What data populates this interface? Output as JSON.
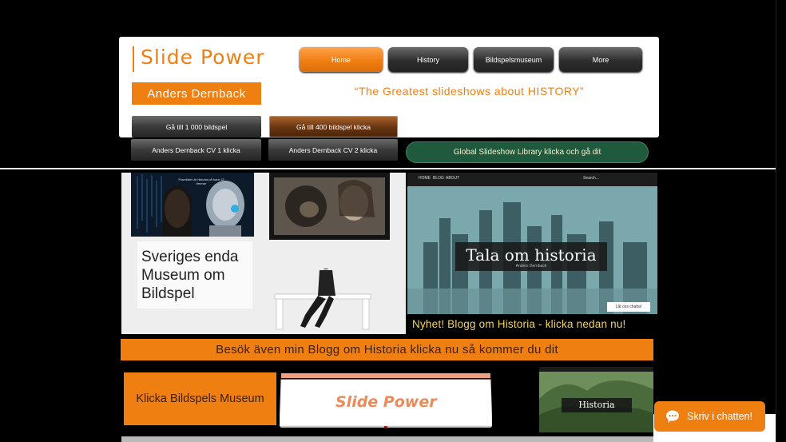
{
  "header": {
    "site_title": "Slide Power",
    "author": "Anders Dernback",
    "tagline": "“The Greatest slideshows about HISTORY”"
  },
  "nav": {
    "items": [
      {
        "label": "Home",
        "active": true
      },
      {
        "label": "History",
        "active": false
      },
      {
        "label": "Bildspelsmuseum",
        "active": false
      },
      {
        "label": "More",
        "active": false
      }
    ]
  },
  "buttons": {
    "goto_1000": "Gå till 1 000 bildspel",
    "goto_400": "Gå till 400 bildspel klicka",
    "cv1": "Anders Dernback CV 1 klicka",
    "cv2": "Anders Dernback CV 2 klicka",
    "global_library": "Global Slideshow Library klicka och gå dit"
  },
  "main": {
    "museum_text": "Sveriges enda Museum om Bildspel",
    "blog_title": "Tala om historia",
    "blog_subtitle": "Anders Dernback",
    "blog_nav": [
      "HOME",
      "BLOG",
      "ABOUT"
    ],
    "blog_search": "Search...",
    "blog_chat": "Låt oss chatta!",
    "ai_poster_text": "Framtiden är historia på bara 12 timmar",
    "blog_news": "Nyhet! Blogg om Historia - klicka nedan nu!",
    "blog_link": "Besök även min Blogg om Historia klicka nu så kommer du dit"
  },
  "bottom": {
    "museum_link": "Klicka Bildspels Museum",
    "logo": "Slide Power",
    "history_thumb_title": "Historia"
  },
  "chat": {
    "label": "Skriv i chatten!",
    "icon": "chat-bubble-icon"
  },
  "colors": {
    "accent": "#f07f12",
    "nav_dark": "#2d2d2d",
    "library_green": "#1f5a3e",
    "news_yellow": "#f5d35a"
  }
}
